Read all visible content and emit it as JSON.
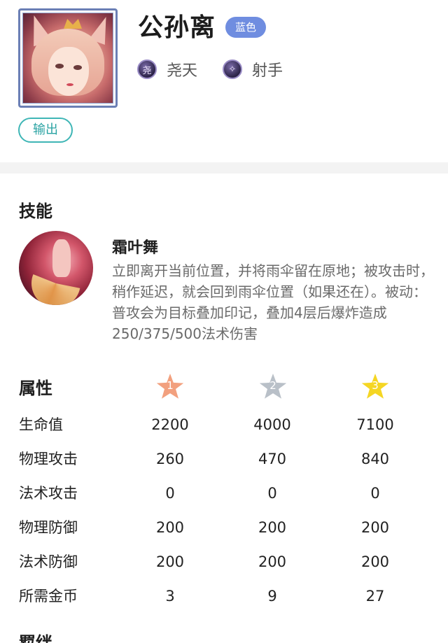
{
  "hero": {
    "name": "公孙离",
    "quality_badge": "蓝色",
    "role_chip": "输出",
    "tags": [
      {
        "icon": "yaotian-emblem-icon",
        "glyph": "尧",
        "label": "尧天"
      },
      {
        "icon": "marksman-class-icon",
        "glyph": "✧",
        "label": "射手"
      }
    ]
  },
  "skills": {
    "title": "技能",
    "skill": {
      "name": "霜叶舞",
      "description": "立即离开当前位置，并将雨伞留在原地；被攻击时，稍作延迟，就会回到雨伞位置（如果还在）。被动：普攻会为目标叠加印记，叠加4层后爆炸造成250/375/500法术伤害"
    }
  },
  "attributes": {
    "title": "属性",
    "stars": [
      {
        "level": "1",
        "color": "#f2a07e"
      },
      {
        "level": "2",
        "color": "#b9c0c8"
      },
      {
        "level": "3",
        "color": "#f5d623"
      }
    ],
    "rows": [
      {
        "label": "生命值",
        "values": [
          "2200",
          "4000",
          "7100"
        ]
      },
      {
        "label": "物理攻击",
        "values": [
          "260",
          "470",
          "840"
        ]
      },
      {
        "label": "法术攻击",
        "values": [
          "0",
          "0",
          "0"
        ]
      },
      {
        "label": "物理防御",
        "values": [
          "200",
          "200",
          "200"
        ]
      },
      {
        "label": "法术防御",
        "values": [
          "200",
          "200",
          "200"
        ]
      },
      {
        "label": "所需金币",
        "values": [
          "3",
          "9",
          "27"
        ]
      }
    ]
  },
  "next_section_title": "羁绊",
  "colors": {
    "badge_blue": "#6f8de0",
    "role_teal": "#3fb6b6",
    "text_gray": "#6a6a6a"
  }
}
